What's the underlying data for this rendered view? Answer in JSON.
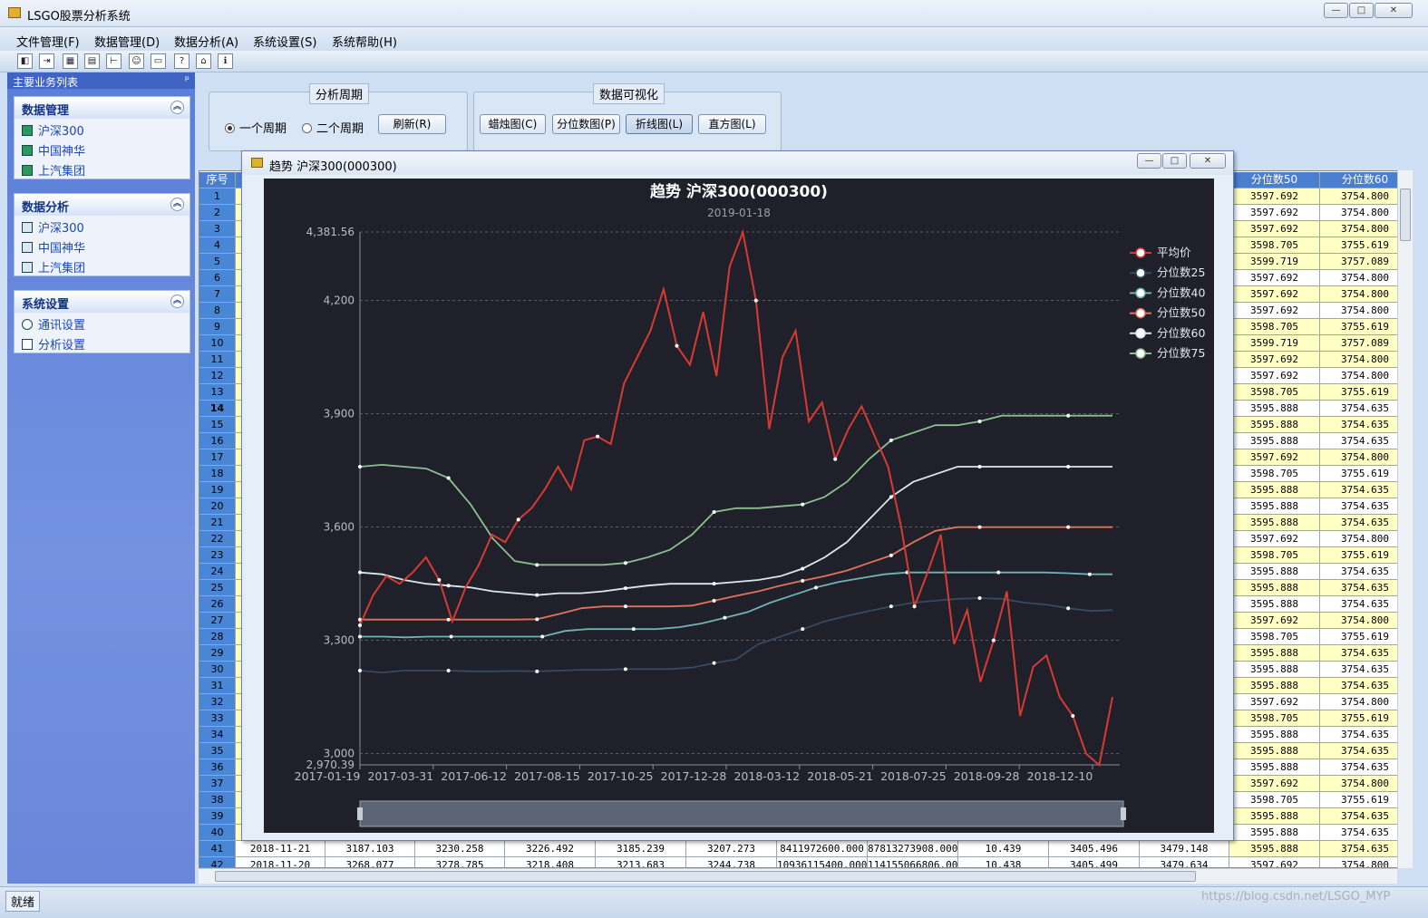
{
  "app": {
    "title": "LSGO股票分析系统"
  },
  "window_buttons": {
    "min": "—",
    "max": "□",
    "close": "✕"
  },
  "menu": [
    "文件管理(F)",
    "数据管理(D)",
    "数据分析(A)",
    "系统设置(S)",
    "系统帮助(H)"
  ],
  "sidebar": {
    "title": "主要业务列表",
    "pin": "ᵖ",
    "groups": [
      {
        "title": "数据管理",
        "items": [
          "沪深300",
          "中国神华",
          "上汽集团"
        ]
      },
      {
        "title": "数据分析",
        "items": [
          "沪深300",
          "中国神华",
          "上汽集团"
        ]
      },
      {
        "title": "系统设置",
        "items": [
          "通讯设置",
          "分析设置"
        ]
      }
    ]
  },
  "period": {
    "legend": "分析周期",
    "opt1": "一个周期",
    "opt2": "二个周期",
    "refresh": "刷新(R)"
  },
  "viz": {
    "legend": "数据可视化",
    "buttons": [
      "蜡烛图(C)",
      "分位数图(P)",
      "折线图(L)",
      "直方图(L)"
    ]
  },
  "grid": {
    "header_first": "序号",
    "header_right": [
      "分位数50",
      "分位数60"
    ],
    "row_numbers": [
      "1",
      "2",
      "3",
      "4",
      "5",
      "6",
      "7",
      "8",
      "9",
      "10",
      "11",
      "12",
      "13",
      "14",
      "15",
      "16",
      "17",
      "18",
      "19",
      "20",
      "21",
      "22",
      "23",
      "24",
      "25",
      "26",
      "27",
      "28",
      "29",
      "30",
      "31",
      "32",
      "33",
      "34",
      "35",
      "36",
      "37",
      "38",
      "39",
      "40",
      "41",
      "42"
    ],
    "q50": [
      "3597.692",
      "3597.692",
      "3597.692",
      "3598.705",
      "3599.719",
      "3597.692",
      "3597.692",
      "3597.692",
      "3598.705",
      "3599.719",
      "3597.692",
      "3597.692",
      "3598.705",
      "3595.888",
      "3595.888",
      "3595.888",
      "3597.692",
      "3598.705",
      "3595.888",
      "3595.888",
      "3595.888",
      "3597.692",
      "3598.705",
      "3595.888",
      "3595.888",
      "3595.888",
      "3597.692",
      "3598.705",
      "3595.888",
      "3595.888",
      "3595.888",
      "3597.692",
      "3598.705",
      "3595.888",
      "3595.888",
      "3595.888",
      "3597.692",
      "3598.705",
      "3595.888",
      "3595.888",
      "3595.888",
      "3597.692"
    ],
    "q60": [
      "3754.800",
      "3754.800",
      "3754.800",
      "3755.619",
      "3757.089",
      "3754.800",
      "3754.800",
      "3754.800",
      "3755.619",
      "3757.089",
      "3754.800",
      "3754.800",
      "3755.619",
      "3754.635",
      "3754.635",
      "3754.635",
      "3754.800",
      "3755.619",
      "3754.635",
      "3754.635",
      "3754.635",
      "3754.800",
      "3755.619",
      "3754.635",
      "3754.635",
      "3754.635",
      "3754.800",
      "3755.619",
      "3754.635",
      "3754.635",
      "3754.635",
      "3754.800",
      "3755.619",
      "3754.635",
      "3754.635",
      "3754.635",
      "3754.800",
      "3755.619",
      "3754.635",
      "3754.635",
      "3754.635",
      "3754.800"
    ],
    "bottom_rows": [
      [
        "2018-11-21",
        "3187.103",
        "3230.258",
        "3226.492",
        "3185.239",
        "3207.273",
        "8411972600.000",
        "87813273908.000",
        "10.439",
        "3405.496",
        "3479.148"
      ],
      [
        "2018-11-20",
        "3268.077",
        "3278.785",
        "3218.408",
        "3213.683",
        "3244.738",
        "10936115400.000",
        "114155066806.000",
        "10.438",
        "3405.499",
        "3479.634"
      ]
    ]
  },
  "status": {
    "text": "就绪",
    "watermark": "https://blog.csdn.net/LSGO_MYP"
  },
  "child": {
    "title": "趋势 沪深300(000300)"
  },
  "chart_data": {
    "type": "line",
    "title": "趋势 沪深300(000300)",
    "subtitle": "2019-01-18",
    "ylim": [
      2970.39,
      4381.56
    ],
    "yticks": [
      "2,970.39",
      "3,000",
      "3,300",
      "3,600",
      "3,900",
      "4,200",
      "4,381.56"
    ],
    "ytick_values": [
      2970.39,
      3000,
      3300,
      3600,
      3900,
      4200,
      4381.56
    ],
    "x": [
      "2017-01-19",
      "2017-03-31",
      "2017-06-12",
      "2017-08-15",
      "2017-10-25",
      "2017-12-28",
      "2018-03-12",
      "2018-05-21",
      "2018-07-25",
      "2018-09-28",
      "2018-12-10"
    ],
    "grid": true,
    "legend_position": "top-right",
    "series": [
      {
        "name": "平均价",
        "color": "#d63b33",
        "values": [
          3340,
          3420,
          3470,
          3450,
          3480,
          3520,
          3460,
          3350,
          3440,
          3500,
          3580,
          3560,
          3620,
          3650,
          3700,
          3760,
          3700,
          3830,
          3840,
          3820,
          3980,
          4050,
          4120,
          4230,
          4080,
          4030,
          4170,
          4000,
          4290,
          4381,
          4200,
          3860,
          4050,
          4120,
          3880,
          3930,
          3780,
          3860,
          3920,
          3840,
          3760,
          3600,
          3390,
          3480,
          3580,
          3290,
          3380,
          3190,
          3300,
          3430,
          3100,
          3230,
          3260,
          3150,
          3100,
          3000,
          2970,
          3150
        ]
      },
      {
        "name": "分位数25",
        "color": "#364a62",
        "values": [
          3220,
          3215,
          3220,
          3220,
          3220,
          3218,
          3218,
          3219,
          3218,
          3220,
          3222,
          3222,
          3224,
          3224,
          3224,
          3228,
          3240,
          3250,
          3290,
          3310,
          3330,
          3350,
          3365,
          3378,
          3390,
          3400,
          3405,
          3410,
          3412,
          3410,
          3400,
          3395,
          3385,
          3378,
          3380
        ]
      },
      {
        "name": "分位数40",
        "color": "#6fb3b6",
        "values": [
          3310,
          3310,
          3308,
          3310,
          3310,
          3310,
          3310,
          3310,
          3310,
          3325,
          3330,
          3330,
          3330,
          3330,
          3335,
          3345,
          3360,
          3375,
          3400,
          3420,
          3440,
          3455,
          3465,
          3475,
          3480,
          3480,
          3480,
          3480,
          3480,
          3480,
          3480,
          3478,
          3475,
          3475
        ]
      },
      {
        "name": "分位数50",
        "color": "#e0735a",
        "values": [
          3355,
          3355,
          3355,
          3355,
          3355,
          3355,
          3355,
          3355,
          3356,
          3370,
          3385,
          3390,
          3390,
          3390,
          3390,
          3392,
          3405,
          3418,
          3430,
          3445,
          3458,
          3470,
          3485,
          3505,
          3525,
          3560,
          3590,
          3600,
          3600,
          3600,
          3600,
          3600,
          3600,
          3600,
          3600
        ]
      },
      {
        "name": "分位数60",
        "color": "#d9e7ee",
        "values": [
          3480,
          3475,
          3460,
          3450,
          3445,
          3440,
          3430,
          3425,
          3420,
          3425,
          3425,
          3430,
          3438,
          3445,
          3450,
          3450,
          3450,
          3455,
          3460,
          3470,
          3490,
          3520,
          3560,
          3620,
          3680,
          3720,
          3740,
          3760,
          3760,
          3760,
          3760,
          3760,
          3760,
          3760,
          3760
        ]
      },
      {
        "name": "分位数75",
        "color": "#8cbf8f",
        "values": [
          3760,
          3765,
          3760,
          3755,
          3730,
          3660,
          3570,
          3510,
          3500,
          3500,
          3500,
          3500,
          3505,
          3520,
          3540,
          3580,
          3640,
          3650,
          3650,
          3655,
          3660,
          3680,
          3720,
          3780,
          3830,
          3850,
          3870,
          3870,
          3880,
          3895,
          3895,
          3895,
          3895,
          3895,
          3895
        ]
      }
    ]
  }
}
